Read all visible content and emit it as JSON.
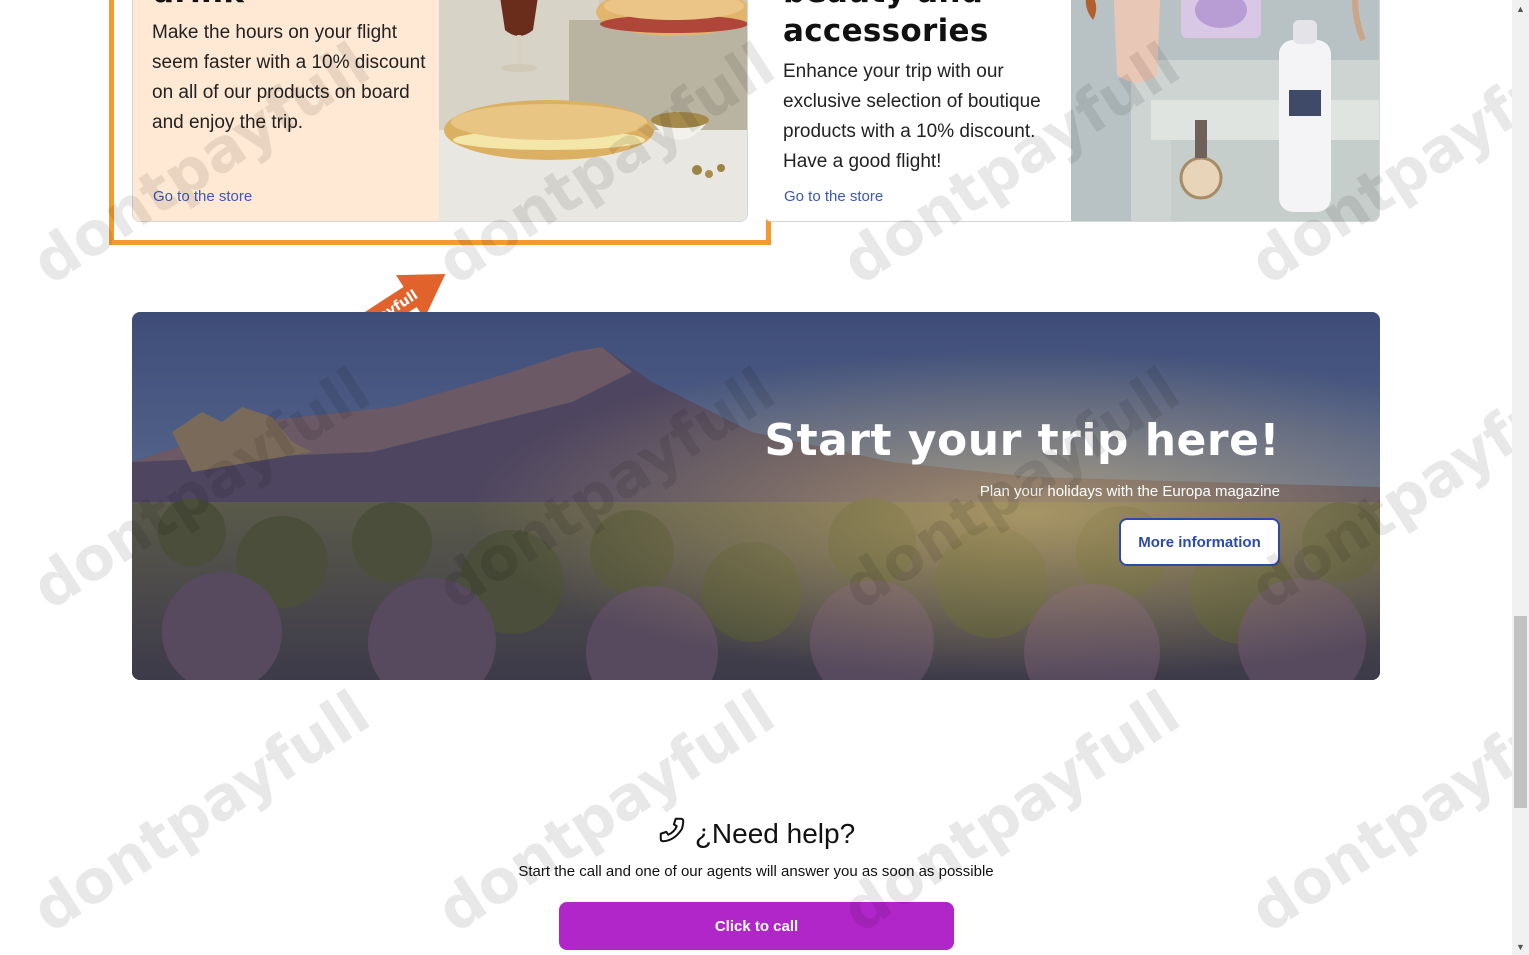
{
  "cards": [
    {
      "title": "drink",
      "description": "Make the hours on your flight seem faster with a 10% discount on all of our products on board and enjoy the trip.",
      "link": "Go to the store"
    },
    {
      "title_line1": "beauty and",
      "title_line2": "accessories",
      "description": "Enhance your trip with our exclusive selection of boutique products with a 10% discount. Have a good flight!",
      "link": "Go to the store"
    }
  ],
  "sticker": {
    "label": "dontpayfull"
  },
  "hero": {
    "title": "Start your trip here!",
    "subtitle": "Plan your holidays with the Europa magazine",
    "button": "More information"
  },
  "help": {
    "title": "¿Need help?",
    "subtitle": "Start the call and one of our agents will answer you as soon as possible",
    "button": "Click to call"
  },
  "watermark": "dontpayfull",
  "colors": {
    "highlight": "#f29a2e",
    "link": "#3a58b5",
    "call_button": "#b026c9",
    "food_card_bg": "#ffe9d4"
  }
}
